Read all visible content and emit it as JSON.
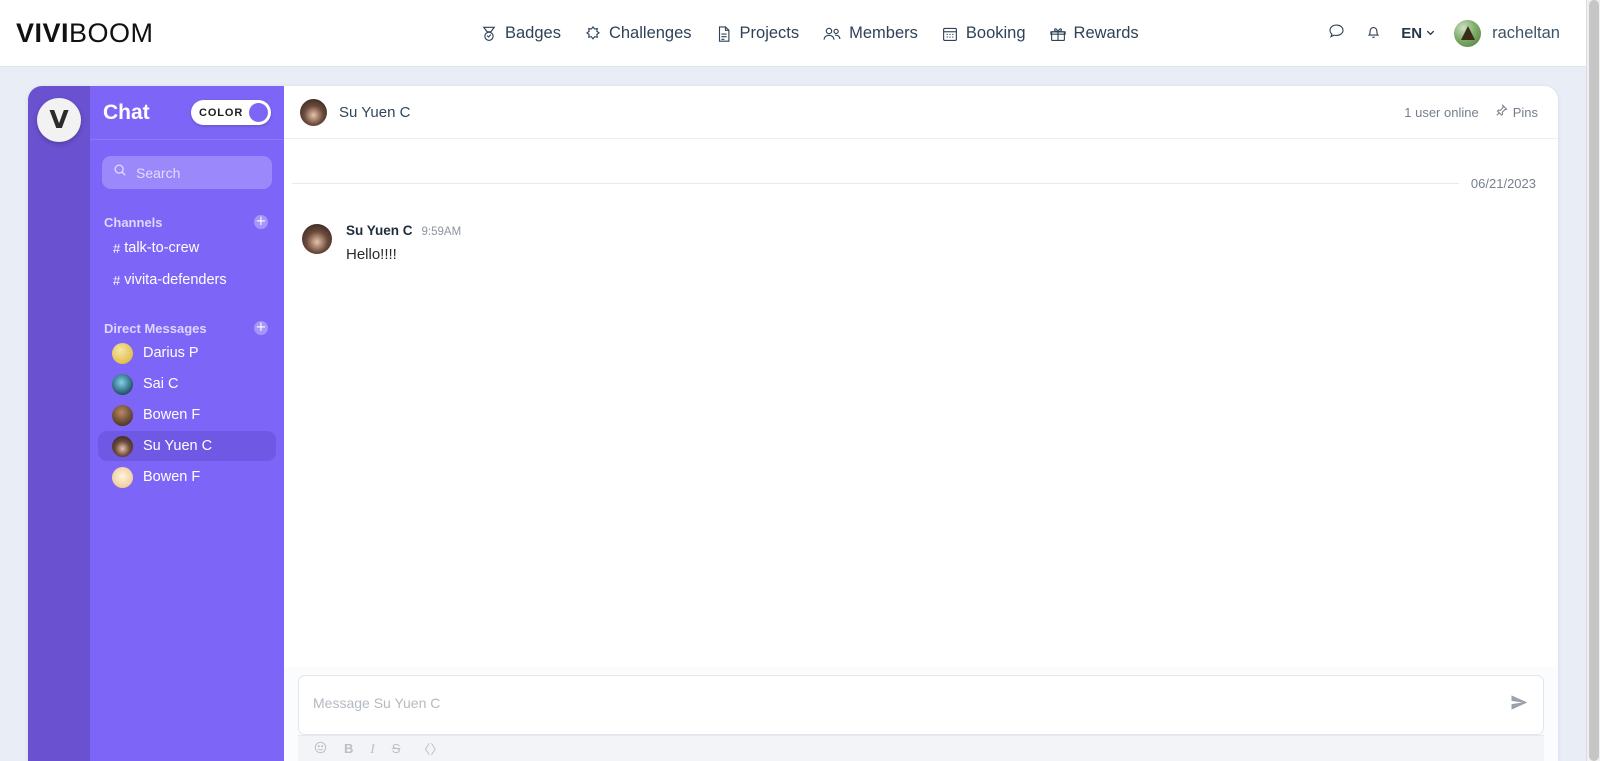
{
  "brand": {
    "bold": "VIVI",
    "light": "BOOM"
  },
  "nav": {
    "items": [
      {
        "label": "Badges",
        "icon": "medal-icon"
      },
      {
        "label": "Challenges",
        "icon": "puzzle-icon"
      },
      {
        "label": "Projects",
        "icon": "document-icon"
      },
      {
        "label": "Members",
        "icon": "people-icon"
      },
      {
        "label": "Booking",
        "icon": "calendar-icon"
      },
      {
        "label": "Rewards",
        "icon": "gift-icon"
      }
    ]
  },
  "topright": {
    "message_icon": "chat-bubble-icon",
    "notification_icon": "bell-icon",
    "language": "EN",
    "username": "racheltan"
  },
  "sidebar": {
    "rail_logo": "V",
    "title": "Chat",
    "toggle": {
      "label": "COLOR",
      "on": true
    },
    "search_placeholder": "Search",
    "channels": {
      "title": "Channels",
      "add_label": "+",
      "items": [
        {
          "hash": "#",
          "label": "talk-to-crew"
        },
        {
          "hash": "#",
          "label": "vivita-defenders"
        }
      ]
    },
    "direct_messages": {
      "title": "Direct Messages",
      "add_label": "+",
      "items": [
        {
          "label": "Darius P",
          "color": "#e8c760",
          "selected": false
        },
        {
          "label": "Sai C",
          "color": "#2c3a48",
          "selected": false
        },
        {
          "label": "Bowen F",
          "color": "#56402f",
          "selected": false
        },
        {
          "label": "Su Yuen C",
          "color": "#3a2c28",
          "selected": true
        },
        {
          "label": "Bowen F",
          "color": "#f3d9b0",
          "selected": false
        }
      ]
    }
  },
  "conversation": {
    "header": {
      "name": "Su Yuen C",
      "online_status": "1 user online",
      "pins_label": "Pins",
      "pin_icon": "pin-icon"
    },
    "date_divider": "06/21/2023",
    "messages": [
      {
        "author": "Su Yuen C",
        "time": "9:59AM",
        "text": "Hello!!!!"
      }
    ],
    "composer": {
      "placeholder": "Message Su Yuen C",
      "send_icon": "send-icon",
      "tools": [
        {
          "name": "emoji-icon",
          "glyph": "☺",
          "style": "e"
        },
        {
          "name": "bold-icon",
          "glyph": "B",
          "style": "b"
        },
        {
          "name": "italic-icon",
          "glyph": "I",
          "style": "i"
        },
        {
          "name": "strikethrough-icon",
          "glyph": "S",
          "style": "s"
        },
        {
          "name": "code-icon",
          "glyph": "〈〉",
          "style": "c"
        }
      ]
    }
  },
  "colors": {
    "page_bg": "#e9edf5",
    "sidebar": "#7d66f7",
    "rail": "#6a51cf",
    "selected": "#6f58e4"
  }
}
